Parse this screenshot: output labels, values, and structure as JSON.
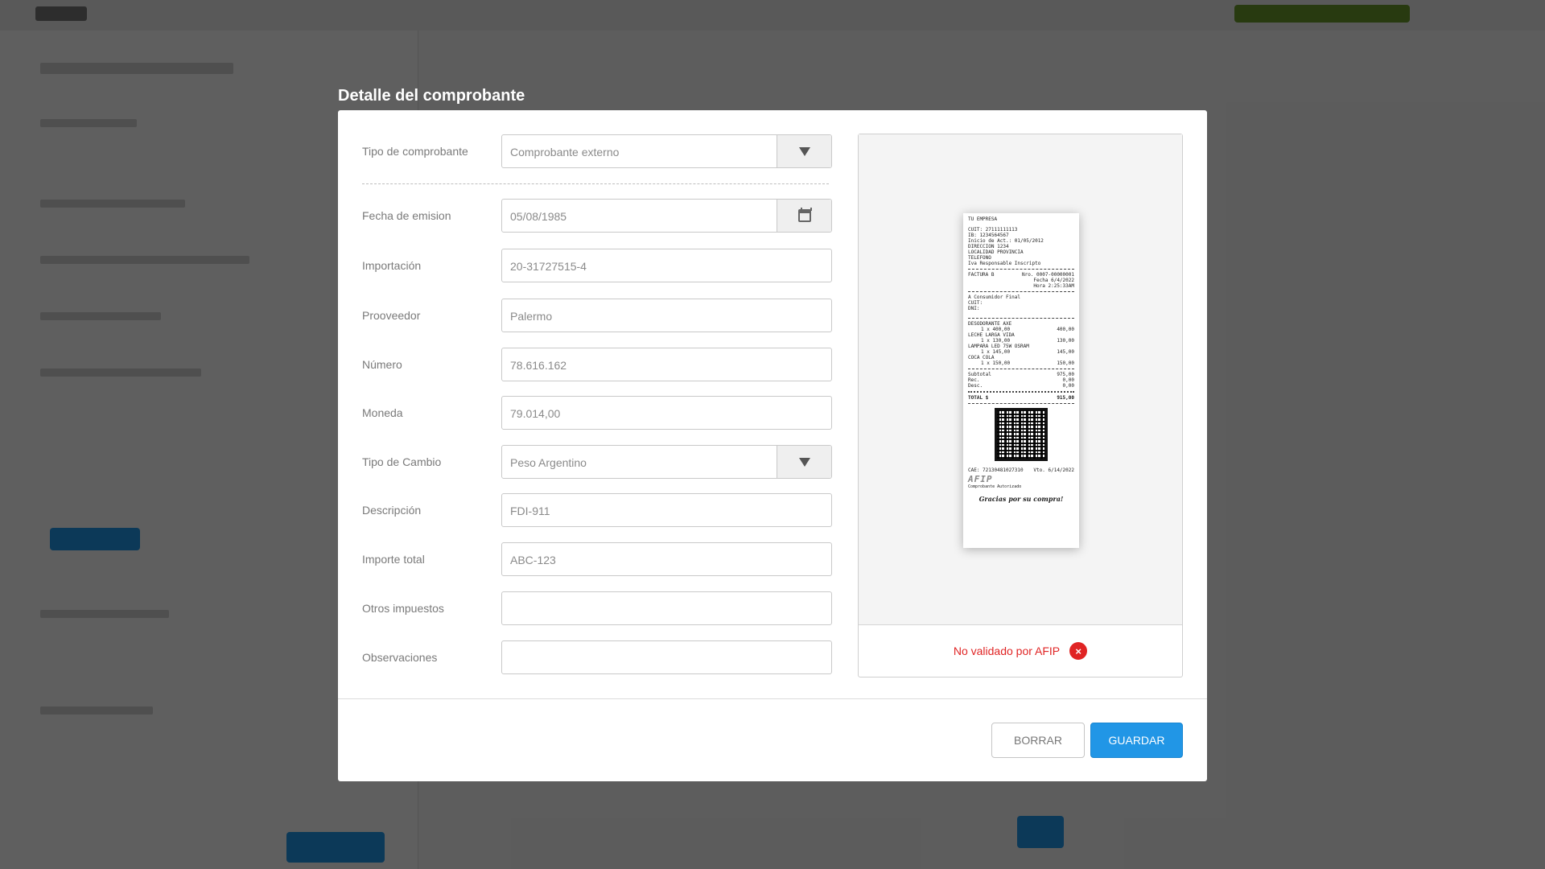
{
  "modal": {
    "title": "Detalle del comprobante",
    "fields": {
      "tipo_comprobante": {
        "label": "Tipo de comprobante",
        "value": "Comprobante externo"
      },
      "fecha_emision": {
        "label": "Fecha de emision",
        "value": "05/08/1985"
      },
      "importacion": {
        "label": "Importación",
        "value": "20-31727515-4"
      },
      "proveedor": {
        "label": "Prooveedor",
        "value": "Palermo"
      },
      "numero": {
        "label": "Número",
        "value": "78.616.162"
      },
      "moneda": {
        "label": "Moneda",
        "value": "79.014,00"
      },
      "tipo_cambio": {
        "label": "Tipo de Cambio",
        "value": "Peso Argentino"
      },
      "descripcion": {
        "label": "Descripción",
        "value": "FDI-911"
      },
      "importe_total": {
        "label": "Importe total",
        "value": "ABC-123"
      },
      "otros_impuestos": {
        "label": "Otros impuestos",
        "value": ""
      },
      "observaciones": {
        "label": "Observaciones",
        "value": ""
      }
    },
    "preview": {
      "receipt": {
        "company": "TU EMPRESA",
        "cuit": "CUIT:   27111111113",
        "ib": "IB:    1234564567",
        "inicio": "Inicio de Act.:   01/05/2012",
        "direccion": "DIRECCION 1234",
        "localidad": "LOCALIDAD PROVINCIA",
        "telefono": "TELEFONO",
        "iva": "Iva Responsable Inscripto",
        "factura": "FACTURA B",
        "nro": "Nro.    0007-00000001",
        "fecha": "Fecha     6/4/2022",
        "hora": "Hora     2:25:33AM",
        "consumidor": "A Consumidor Final",
        "cuit_cliente": "CUIT:",
        "dni": "DNI:",
        "items": [
          {
            "name": "DESODORANTE AXE",
            "qty": "1  x   400,00",
            "amount": "400,00"
          },
          {
            "name": "LECHE LARGA VIDA",
            "qty": "1  x   130,00",
            "amount": "130,00"
          },
          {
            "name": "LAMPARA LED 75W OSRAM",
            "qty": "1  x   145,00",
            "amount": "145,00"
          },
          {
            "name": "COCA COLA",
            "qty": "1  x   150,00",
            "amount": "150,00"
          }
        ],
        "subtotal_label": "Subtotal",
        "subtotal": "975,00",
        "rec_label": "Rec.",
        "rec": "0,00",
        "desc_label": "Desc.",
        "desc": "0,00",
        "total_label": "TOTAL   $",
        "total": "915,00",
        "cae": "CAE: 72130481027310",
        "vto": "Vto.  6/14/2022",
        "logo": "AFIP",
        "autorizado": "Comprobante Autorizado",
        "thanks": "Gracias por su compra!"
      },
      "status_text": "No validado por AFIP",
      "status_icon": "×"
    },
    "buttons": {
      "clear": "BORRAR",
      "save": "GUARDAR"
    }
  },
  "colors": {
    "primary": "#2196e6",
    "error": "#e02424",
    "overlay": "rgba(0,0,0,0.62)"
  }
}
